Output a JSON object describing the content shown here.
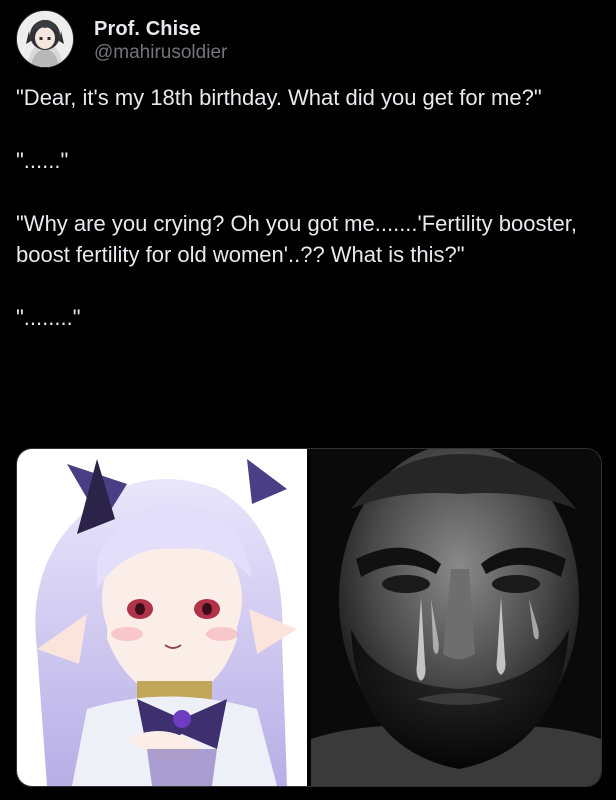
{
  "author": {
    "display_name": "Prof. Chise",
    "handle": "@mahirusoldier",
    "avatar_icon": "anime-avatar-icon"
  },
  "tweet": {
    "paragraphs": [
      "\"Dear, it's my 18th birthday. What did you get for me?\"",
      "\"......\"",
      "\"Why are you crying? Oh you got me.......'Fertility booster, boost fertility for old women'..?? What is this?\"",
      "\"........\""
    ]
  },
  "media": {
    "images": [
      {
        "icon": "anime-girl-illustration"
      },
      {
        "icon": "crying-bearded-man-photo"
      }
    ]
  },
  "colors": {
    "background": "#000000",
    "text": "#e7e9ea",
    "secondary_text": "#71767b"
  }
}
